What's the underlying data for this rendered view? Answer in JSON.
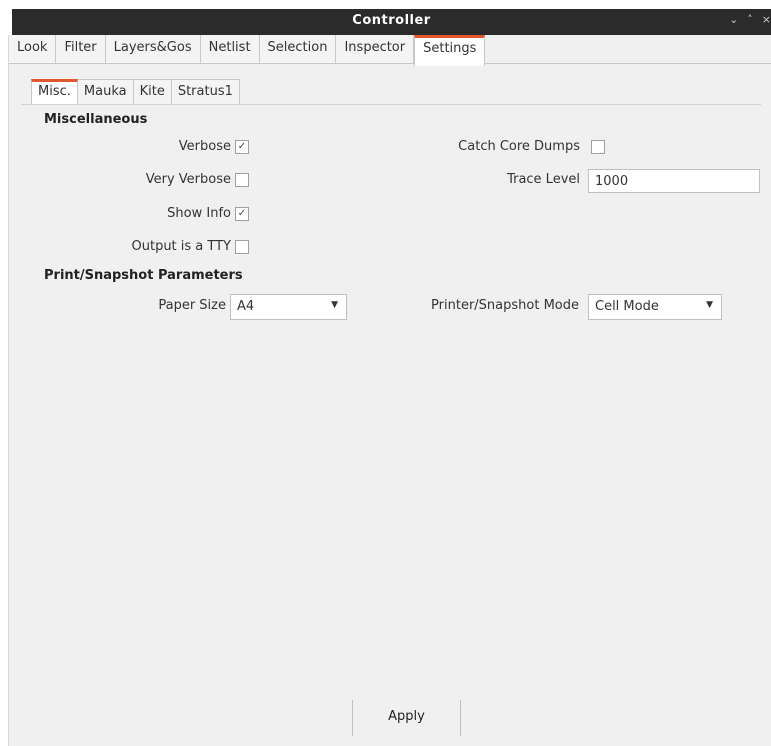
{
  "window": {
    "title": "Controller",
    "controls": [
      "⌄",
      "˄",
      "×"
    ]
  },
  "top_tabs": [
    "Look",
    "Filter",
    "Layers&Gos",
    "Netlist",
    "Selection",
    "Inspector",
    "Settings"
  ],
  "active_top_tab": "Settings",
  "sub_tabs": [
    "Misc.",
    "Mauka",
    "Kite",
    "Stratus1"
  ],
  "active_sub_tab": "Misc.",
  "misc": {
    "section_title": "Miscellaneous",
    "verbose_label": "Verbose",
    "verbose_checked": true,
    "very_verbose_label": "Very Verbose",
    "very_verbose_checked": false,
    "show_info_label": "Show Info",
    "show_info_checked": true,
    "output_tty_label": "Output is a TTY",
    "output_tty_checked": false,
    "catch_core_label": "Catch Core Dumps",
    "catch_core_checked": false,
    "trace_level_label": "Trace Level",
    "trace_level_value": "1000"
  },
  "print": {
    "section_title": "Print/Snapshot Parameters",
    "paper_size_label": "Paper Size",
    "paper_size_value": "A4",
    "mode_label": "Printer/Snapshot Mode",
    "mode_value": "Cell Mode"
  },
  "apply_label": "Apply",
  "colors": {
    "accent": "#e2582c",
    "titlebar": "#2b2b2b"
  }
}
